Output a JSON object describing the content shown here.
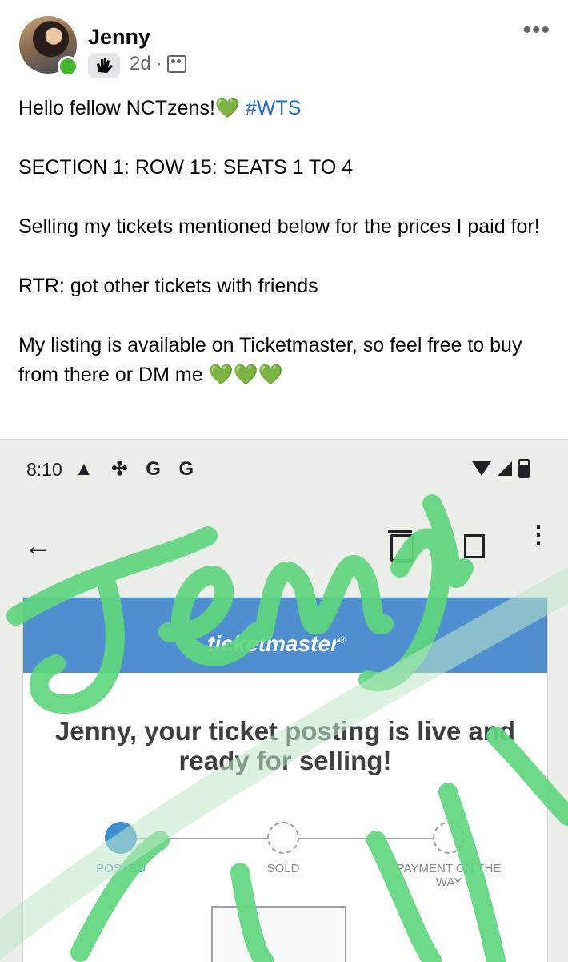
{
  "post": {
    "author": "Jenny",
    "time": "2d",
    "separator": "·",
    "more": "•••",
    "lines": [
      "Hello fellow NCTzens!💚",
      "SECTION 1: ROW 15: SEATS 1 TO 4",
      "Selling my tickets mentioned below for the prices I paid for!",
      "RTR: got other tickets with friends",
      "My listing is available on Ticketmaster, so feel free to buy from there or DM me 💚💚💚"
    ],
    "hashtag": "#WTS"
  },
  "screenshot": {
    "status_time": "8:10",
    "status_icons": "▲ ✣ G G",
    "back": "←",
    "overflow": "⋮",
    "brand": "ticketmaster",
    "brand_mark": "®",
    "headline": "Jenny, your ticket posting is live and ready for selling!",
    "steps": [
      "POSTED",
      "SOLD",
      "PAYMENT ON THE WAY"
    ],
    "watermark": "Jenny",
    "watermark_color": "#5fd67e"
  },
  "colors": {
    "hashtag": "#216fdb",
    "online": "#42b72a",
    "tm_blue": "#4f8fd0"
  }
}
